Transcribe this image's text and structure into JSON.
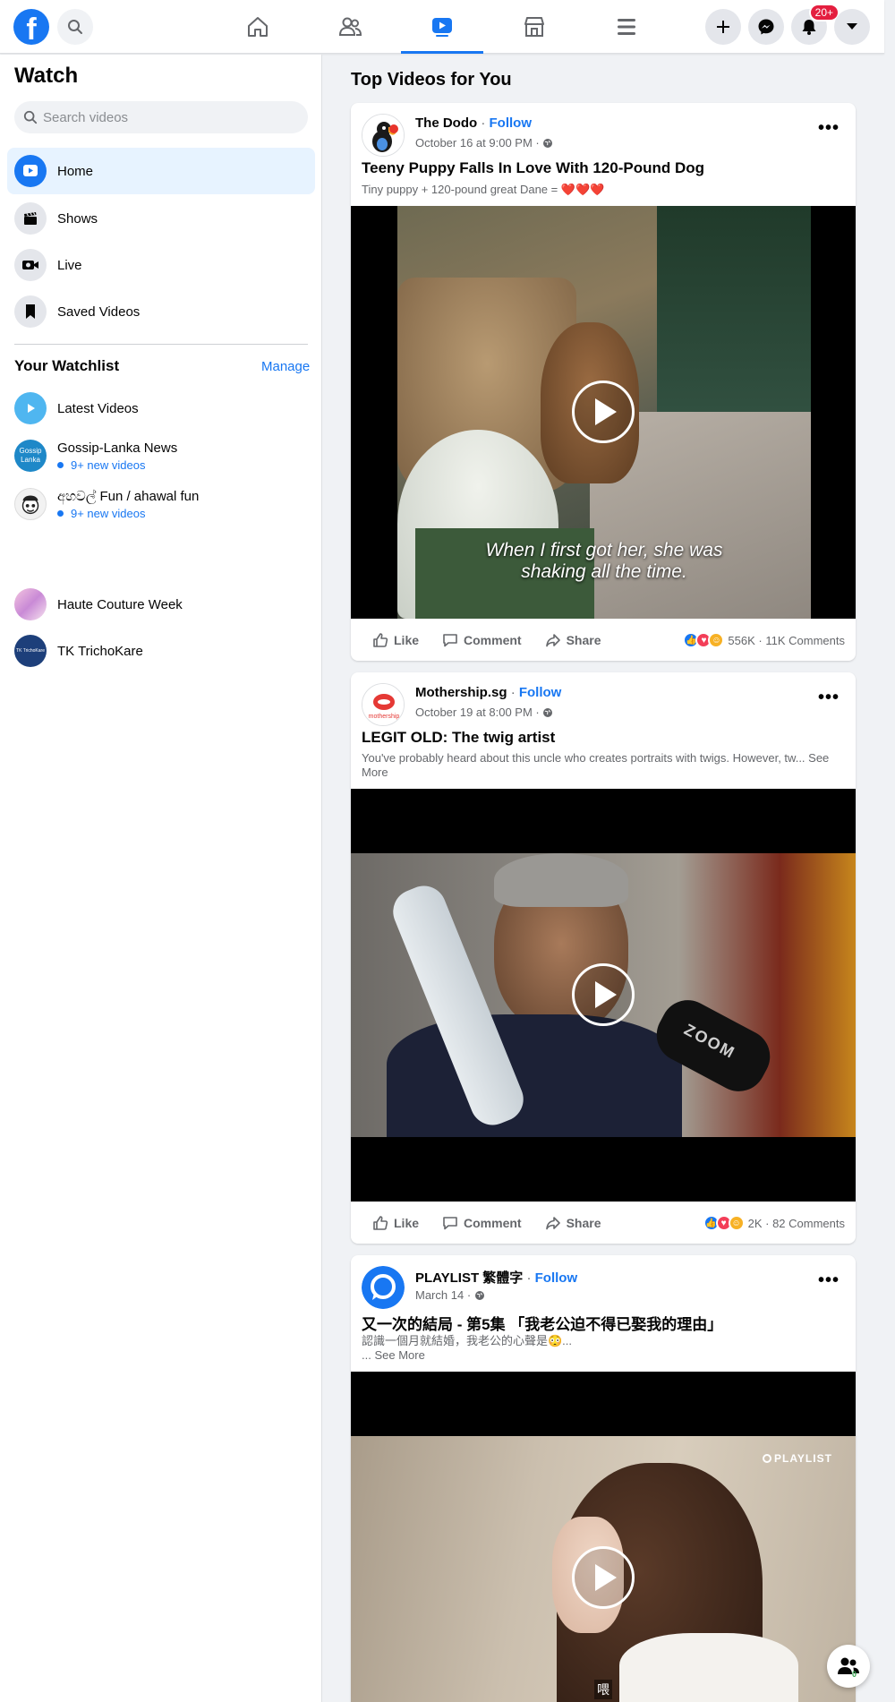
{
  "nav": {
    "logo": "f",
    "tabs": [
      "home-icon",
      "friends-icon",
      "watch-icon",
      "marketplace-icon",
      "menu-icon"
    ],
    "notifications_badge": "20+",
    "accent": "#1877f2"
  },
  "sidebar": {
    "title": "Watch",
    "search_placeholder": "Search videos",
    "items": [
      {
        "label": "Home",
        "icon": "play-icon"
      },
      {
        "label": "Shows",
        "icon": "clapper-icon"
      },
      {
        "label": "Live",
        "icon": "live-camera-icon"
      },
      {
        "label": "Saved Videos",
        "icon": "bookmark-icon"
      }
    ],
    "watchlist_title": "Your Watchlist",
    "manage": "Manage",
    "watchlist": [
      {
        "name": "Latest Videos",
        "sub": ""
      },
      {
        "name": "Gossip-Lanka News",
        "sub": "9+ new videos",
        "avatar_text": "Gossip Lanka"
      },
      {
        "name": "අහවල් Fun / ahawal fun",
        "sub": "9+ new videos"
      },
      {
        "name": "Haute Couture Week",
        "sub": ""
      },
      {
        "name": "TK TrichoKare",
        "sub": "",
        "avatar_text": "TK TrichoKare"
      }
    ]
  },
  "feed": {
    "title": "Top Videos for You",
    "posts": [
      {
        "page": "The Dodo",
        "follow": "Follow",
        "date": "October 16 at 9:00 PM",
        "title": "Teeny Puppy Falls In Love With 120-Pound Dog",
        "desc": "Tiny puppy + 120-pound great Dane = ❤️❤️❤️",
        "caption_line1": "When I first got her, she was",
        "caption_line2": "shaking all the time.",
        "reactions_count": "556K",
        "comments": "11K Comments"
      },
      {
        "page": "Mothership.sg",
        "follow": "Follow",
        "date": "October 19 at 8:00 PM",
        "title": "LEGIT OLD: The twig artist",
        "desc": "You've probably heard about this uncle who creates portraits with twigs. However, tw... See More",
        "avatar_text": "mothership",
        "mic_text": "ZOOM",
        "reactions_count": "2K",
        "comments": "82 Comments"
      },
      {
        "page": "PLAYLIST 繁體字",
        "follow": "Follow",
        "date": "March 14",
        "title": "又一次的結局 - 第5集 「我老公迫不得已娶我的理由」",
        "desc_line1": "認識一個月就結婚，我老公的心聲是😳...",
        "desc_line2": "... See More",
        "watermark": "PLAYLIST",
        "subtitle_char": "喂"
      }
    ],
    "actions": {
      "like": "Like",
      "comment": "Comment",
      "share": "Share"
    }
  },
  "floating": {
    "count": "0"
  }
}
